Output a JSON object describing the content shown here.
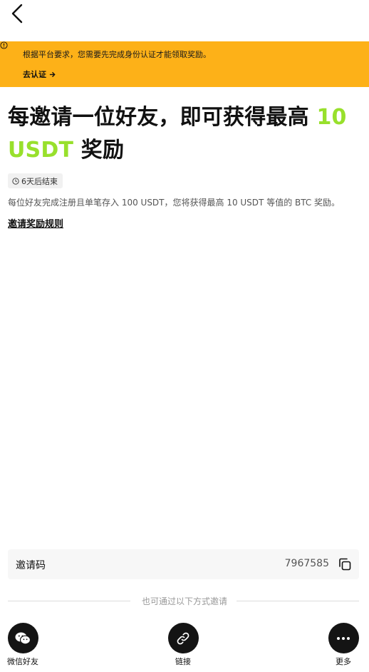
{
  "header": {
    "back_icon": "chevron-left-icon"
  },
  "banner": {
    "background": "#fdb118",
    "icon": "info-icon",
    "message": "根据平台要求，您需要先完成身份认证才能领取奖励。",
    "link_label": "去认证",
    "link_icon": "arrow-right-icon"
  },
  "headline": {
    "prefix": "每邀请一位好友，即可获得最高 ",
    "amount": "10 USDT",
    "suffix": " 奖励",
    "accent_color": "#98e02c"
  },
  "countdown": {
    "icon": "clock-icon",
    "text": "6天后结束"
  },
  "description": "每位好友完成注册且单笔存入 100 USDT，您将获得最高  10 USDT 等值的 BTC 奖励。",
  "rules_link": "邀请奖励规则",
  "invite_code": {
    "label": "邀请码",
    "value": "7967585",
    "copy_icon": "copy-icon"
  },
  "share": {
    "divider_text": "也可通过以下方式邀请",
    "options": [
      {
        "label": "微信好友",
        "icon": "wechat-icon"
      },
      {
        "label": "链接",
        "icon": "link-icon"
      },
      {
        "label": "更多",
        "icon": "more-icon"
      }
    ]
  }
}
